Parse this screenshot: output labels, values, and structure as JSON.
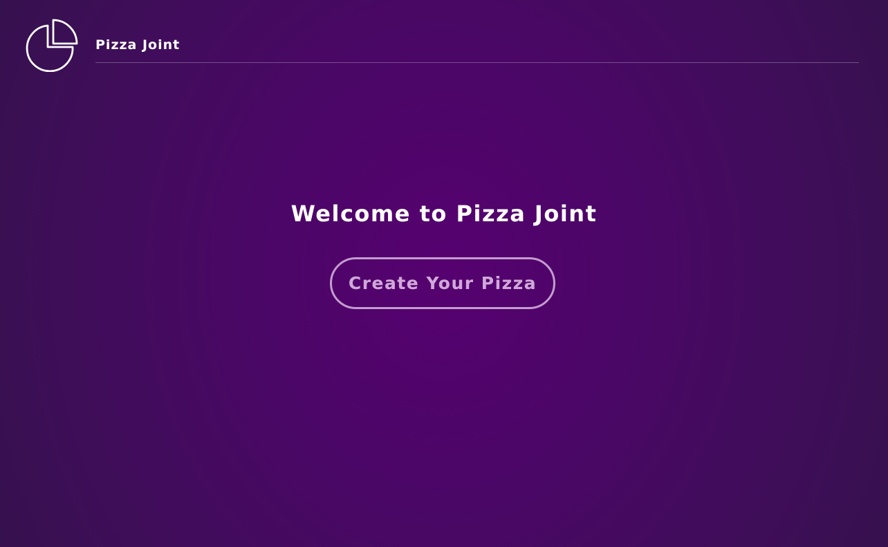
{
  "header": {
    "logo_icon": "pie-chart-icon",
    "brand_name": "Pizza Joint"
  },
  "main": {
    "welcome_title": "Welcome to Pizza Joint",
    "cta_label": "Create Your Pizza"
  },
  "colors": {
    "background_center": "#560170",
    "background_edge": "#32124a",
    "text": "#ffffff",
    "button_border": "#e6c8eb"
  }
}
